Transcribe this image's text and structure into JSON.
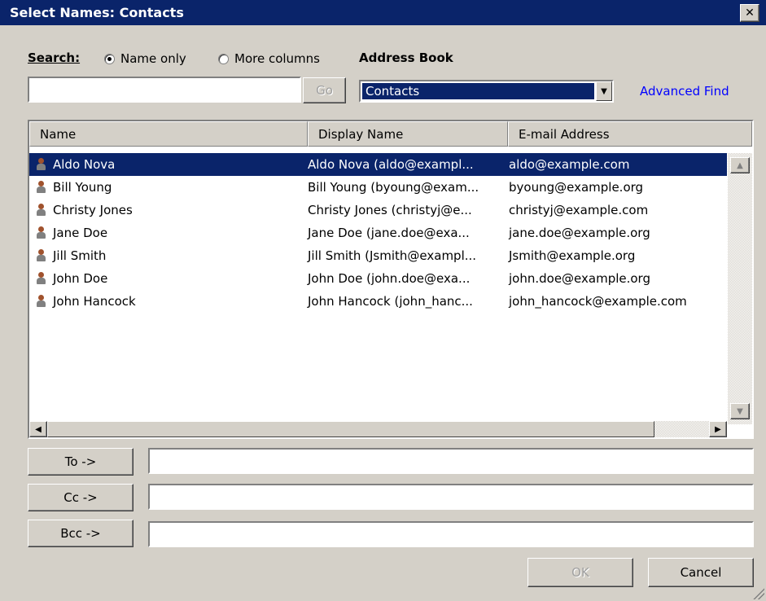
{
  "window": {
    "title": "Select Names: Contacts",
    "close_glyph": "✕"
  },
  "search": {
    "label": "Search:",
    "options": [
      {
        "label": "Name only",
        "selected": true
      },
      {
        "label": "More columns",
        "selected": false
      }
    ],
    "input_value": "",
    "go_label": "Go"
  },
  "address_book": {
    "label": "Address Book",
    "selected": "Contacts"
  },
  "advanced_find": "Advanced Find",
  "columns": [
    "Name",
    "Display Name",
    "E-mail Address"
  ],
  "contacts": [
    {
      "name": "Aldo Nova",
      "display": "Aldo Nova (aldo@exampl...",
      "email": "aldo@example.com",
      "selected": true
    },
    {
      "name": "Bill Young",
      "display": "Bill Young (byoung@exam...",
      "email": "byoung@example.org",
      "selected": false
    },
    {
      "name": "Christy Jones",
      "display": "Christy Jones (christyj@e...",
      "email": "christyj@example.com",
      "selected": false
    },
    {
      "name": "Jane Doe",
      "display": "Jane Doe (jane.doe@exa...",
      "email": "jane.doe@example.org",
      "selected": false
    },
    {
      "name": "Jill Smith",
      "display": "Jill Smith (Jsmith@exampl...",
      "email": "Jsmith@example.org",
      "selected": false
    },
    {
      "name": "John Doe",
      "display": "John Doe (john.doe@exa...",
      "email": "john.doe@example.org",
      "selected": false
    },
    {
      "name": "John Hancock",
      "display": "John Hancock (john_hanc...",
      "email": "john_hancock@example.com",
      "selected": false
    }
  ],
  "recipients": {
    "to_label": "To ->",
    "to_value": "",
    "cc_label": "Cc ->",
    "cc_value": "",
    "bcc_label": "Bcc ->",
    "bcc_value": ""
  },
  "buttons": {
    "ok": "OK",
    "cancel": "Cancel"
  },
  "colors": {
    "titlebar": "#0a246a",
    "face": "#d4d0c8",
    "link": "#0000ff",
    "selection": "#0a246a"
  }
}
